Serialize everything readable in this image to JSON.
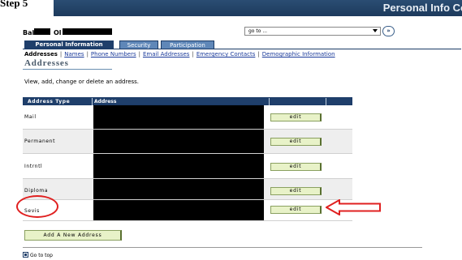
{
  "step_caption": "Step 5",
  "banner": {
    "title": "Personal Info Co"
  },
  "student": {
    "first_name_fragment": "Bab",
    "last_name_fragment": "Ol"
  },
  "goto": {
    "value": "go to ...",
    "button_label": "»"
  },
  "tabs": [
    {
      "label": "Personal Information",
      "active": true
    },
    {
      "label": "Security",
      "active": false
    },
    {
      "label": "Participation",
      "active": false
    }
  ],
  "sublinks": [
    {
      "label": "Addresses",
      "current": true
    },
    {
      "label": "Names",
      "current": false
    },
    {
      "label": "Phone Numbers",
      "current": false
    },
    {
      "label": "Email Addresses",
      "current": false
    },
    {
      "label": "Emergency Contacts",
      "current": false
    },
    {
      "label": "Demographic Information",
      "current": false
    }
  ],
  "separator": "|",
  "page_title": "Addresses",
  "instructions": "View, add, change or delete an address.",
  "table": {
    "headers": {
      "type": "Address Type",
      "address": "Address"
    },
    "rows": [
      {
        "type": "Mail",
        "action": "edit"
      },
      {
        "type": "Permanent",
        "action": "edit"
      },
      {
        "type": "Intrntl",
        "action": "edit"
      },
      {
        "type": "Diploma",
        "action": "edit"
      },
      {
        "type": "Sevis",
        "action": "edit"
      }
    ]
  },
  "add_button_label": "Add A New Address",
  "go_to_top": "Go to top",
  "colors": {
    "banner": "#1f3f6b",
    "annotation": "#e02020",
    "button_fill": "#e8f2c8"
  }
}
